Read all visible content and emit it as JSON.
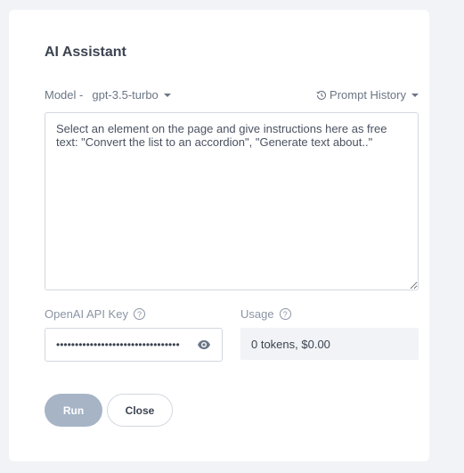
{
  "dialog": {
    "title": "AI Assistant"
  },
  "model": {
    "label": "Model -",
    "value": "gpt-3.5-turbo"
  },
  "prompt_history": {
    "label": "Prompt History",
    "icon": "history-icon"
  },
  "prompt": {
    "placeholder": "Select an element on the page and give instructions here as free text: \"Convert the list to an accordion\", \"Generate text about..\"",
    "value": ""
  },
  "api_key": {
    "label": "OpenAI API Key",
    "value": "sk-xxxxxxxxxxxxxxxxxxxxxxxxxxxxxx",
    "help": "?"
  },
  "usage": {
    "label": "Usage",
    "value": "0 tokens, $0.00",
    "help": "?"
  },
  "buttons": {
    "run": "Run",
    "close": "Close"
  },
  "colors": {
    "background": "#f1f3f6",
    "run_button": "#a6b4c6",
    "text": "#3b4350"
  }
}
